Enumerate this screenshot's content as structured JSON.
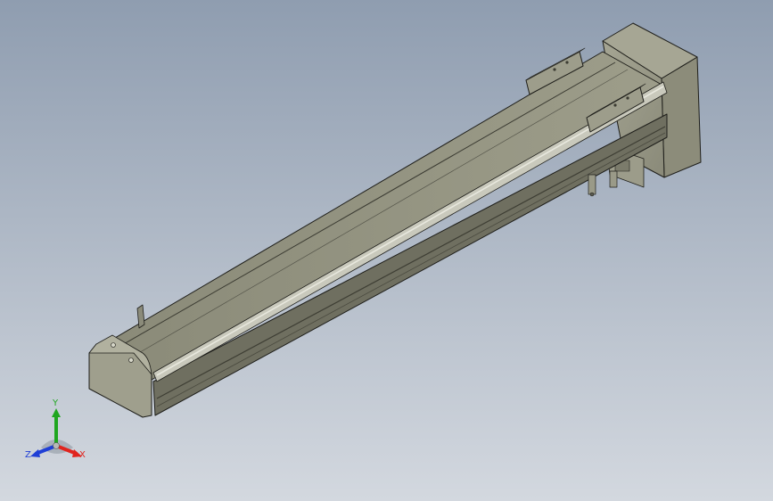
{
  "colors": {
    "background_top": "#8f9db0",
    "background_bottom": "#d3d8df",
    "body_top": "#8e8e7c",
    "body_front": "#6f6f60",
    "body_side": "#9a9a88",
    "edge": "#1e1e1a",
    "rail": "#c9c9bc",
    "axis_x": "#e0241e",
    "axis_y": "#1fa61f",
    "axis_z": "#1f3fd6"
  },
  "icons": {
    "triad": "coordinate-triad-icon"
  },
  "triad": {
    "x_label": "X",
    "y_label": "Y",
    "z_label": "Z"
  }
}
